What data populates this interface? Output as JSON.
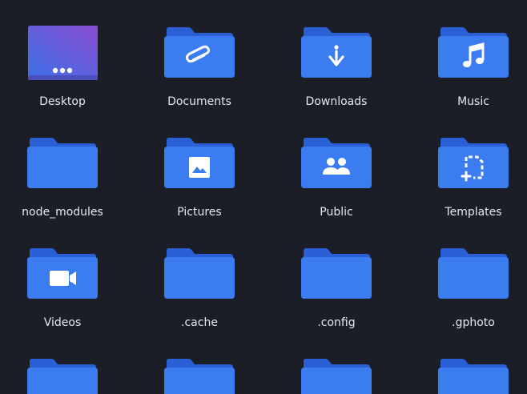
{
  "folders": [
    {
      "label": "Desktop",
      "icon": "desktop-icon"
    },
    {
      "label": "Documents",
      "icon": "paperclip-icon"
    },
    {
      "label": "Downloads",
      "icon": "download-icon"
    },
    {
      "label": "Music",
      "icon": "music-note-icon"
    },
    {
      "label": "node_modules",
      "icon": "plain-folder-icon"
    },
    {
      "label": "Pictures",
      "icon": "image-icon"
    },
    {
      "label": "Public",
      "icon": "people-icon"
    },
    {
      "label": "Templates",
      "icon": "template-icon"
    },
    {
      "label": "Videos",
      "icon": "video-camera-icon"
    },
    {
      "label": ".cache",
      "icon": "plain-folder-icon"
    },
    {
      "label": ".config",
      "icon": "plain-folder-icon"
    },
    {
      "label": ".gphoto",
      "icon": "plain-folder-icon"
    },
    {
      "label": "",
      "icon": "plain-folder-icon"
    },
    {
      "label": "",
      "icon": "plain-folder-icon"
    },
    {
      "label": "",
      "icon": "plain-folder-icon"
    },
    {
      "label": "",
      "icon": "plain-folder-icon"
    }
  ],
  "colors": {
    "background": "#1b1e26",
    "folder_back": "#2a5fd6",
    "folder_front": "#3b7cf0",
    "glyph": "#ffffff",
    "desktop_gradient_start": "#4a6fe8",
    "desktop_gradient_end": "#8a4fd0"
  }
}
